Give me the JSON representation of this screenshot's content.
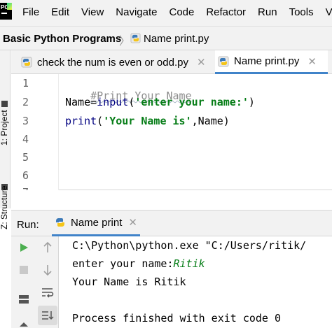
{
  "menubar": {
    "logo_text": "PC",
    "items": [
      "File",
      "Edit",
      "View",
      "Navigate",
      "Code",
      "Refactor",
      "Run",
      "Tools",
      "VCS"
    ]
  },
  "navbar": {
    "project": "Basic Python Programs",
    "file": "Name print.py"
  },
  "left_stripe": {
    "project_label": "1: Project",
    "structure_label": "Z: Structure"
  },
  "tabs": [
    {
      "label": "check the num is even or odd.py",
      "active": false,
      "icon": "python-file-icon"
    },
    {
      "label": "Name print.py",
      "active": true,
      "icon": "python-file-icon"
    }
  ],
  "editor": {
    "line_numbers": [
      "1",
      "2",
      "3",
      "4",
      "5",
      "6",
      "7"
    ],
    "lines": {
      "l1_comment": "#Print Your Name",
      "l2_ident": "Name",
      "l2_op": "=",
      "l2_func": "input",
      "l2_open": "(",
      "l2_string": "'enter your name:'",
      "l2_close": ")",
      "l3_func": "print",
      "l3_open": "(",
      "l3_string": "'Your Name is'",
      "l3_comma": ",",
      "l3_ident": "Name",
      "l3_close": ")"
    }
  },
  "run_panel": {
    "title": "Run:",
    "tab_label": "Name print",
    "toolbar_icons": [
      "run-icon",
      "stop-icon",
      "up-arrow-icon",
      "down-arrow-icon",
      "soft-wrap-icon",
      "layout-icon",
      "scroll-to-end-icon",
      "pin-icon"
    ]
  },
  "console": {
    "cmd": "C:\\Python\\python.exe \"C:/Users/ritik/",
    "prompt": "enter your name:",
    "user_input": "Ritik",
    "output": "Your Name is Ritik",
    "exit": "Process finished with exit code 0"
  },
  "colors": {
    "accent_tab": "#4083c9",
    "string": "#067d17",
    "builtin": "#000080",
    "comment": "#8c8c8c",
    "run_green": "#4caf50"
  }
}
